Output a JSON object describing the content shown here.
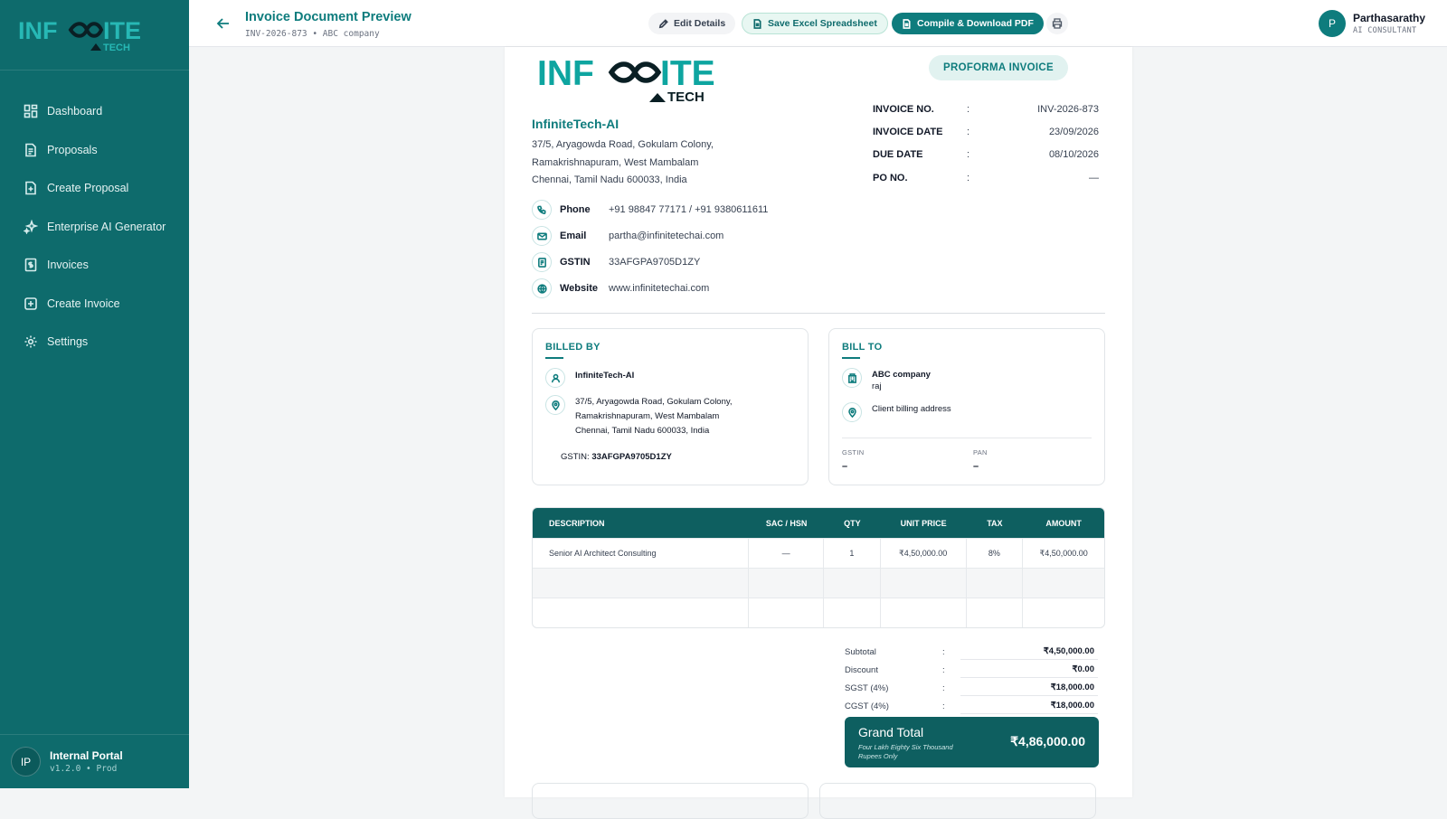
{
  "sidebar": {
    "brand": "INFINITE TECH",
    "items": [
      {
        "label": "Dashboard",
        "icon": "dashboard-icon"
      },
      {
        "label": "Proposals",
        "icon": "document-icon"
      },
      {
        "label": "Create Proposal",
        "icon": "file-plus-icon"
      },
      {
        "label": "Enterprise AI Generator",
        "icon": "sparkles-icon"
      },
      {
        "label": "Invoices",
        "icon": "invoice-icon"
      },
      {
        "label": "Create Invoice",
        "icon": "plus-square-icon"
      },
      {
        "label": "Settings",
        "icon": "gear-icon"
      }
    ],
    "footer": {
      "initials": "IP",
      "title": "Internal Portal",
      "version": "v1.2.0 • Prod"
    }
  },
  "header": {
    "title": "Invoice Document Preview",
    "subtitle": "INV-2026-873 • ABC company",
    "edit_label": "Edit Details",
    "excel_label": "Save Excel Spreadsheet",
    "pdf_label": "Compile & Download PDF",
    "user": {
      "initial": "P",
      "name": "Parthasarathy",
      "role": "AI CONSULTANT"
    }
  },
  "invoice": {
    "badge": "PROFORMA INVOICE",
    "company": "InfiniteTech-AI",
    "address": [
      "37/5, Aryagowda Road, Gokulam Colony,",
      "Ramakrishnapuram, West Mambalam",
      "Chennai, Tamil Nadu 600033, India"
    ],
    "contacts": [
      {
        "label": "Phone",
        "value": "+91 98847 77171 / +91 9380611611"
      },
      {
        "label": "Email",
        "value": "partha@infinitetechai.com"
      },
      {
        "label": "GSTIN",
        "value": "33AFGPA9705D1ZY"
      },
      {
        "label": "Website",
        "value": "www.infinitetechai.com"
      }
    ],
    "meta": [
      {
        "label": "INVOICE NO.",
        "value": "INV-2026-873"
      },
      {
        "label": "INVOICE DATE",
        "value": "23/09/2026"
      },
      {
        "label": "DUE DATE",
        "value": "08/10/2026"
      },
      {
        "label": "PO NO.",
        "value": "—"
      }
    ],
    "colon": ":",
    "billed_by": {
      "heading": "BILLED BY",
      "name": "InfiniteTech-AI",
      "address": [
        "37/5, Aryagowda Road, Gokulam Colony,",
        "Ramakrishnapuram, West Mambalam",
        "Chennai, Tamil Nadu 600033, India"
      ],
      "gstin_label": "GSTIN:",
      "gstin": "33AFGPA9705D1ZY"
    },
    "bill_to": {
      "heading": "BILL TO",
      "name": "ABC company",
      "contact": "raj",
      "address": "Client billing address",
      "gstin_label": "GSTIN",
      "gstin": "–",
      "pan_label": "PAN",
      "pan": "–"
    },
    "table": {
      "headers": [
        "DESCRIPTION",
        "SAC / HSN",
        "QTY",
        "UNIT PRICE",
        "TAX",
        "AMOUNT"
      ],
      "rows": [
        [
          "Senior AI Architect Consulting",
          "—",
          "1",
          "₹4,50,000.00",
          "8%",
          "₹4,50,000.00"
        ],
        [
          "",
          "",
          "",
          "",
          "",
          ""
        ],
        [
          "",
          "",
          "",
          "",
          "",
          ""
        ]
      ]
    },
    "totals": [
      {
        "label": "Subtotal",
        "value": "₹4,50,000.00"
      },
      {
        "label": "Discount",
        "value": "₹0.00"
      },
      {
        "label": "SGST (4%)",
        "value": "₹18,000.00"
      },
      {
        "label": "CGST (4%)",
        "value": "₹18,000.00"
      }
    ],
    "grand_total": {
      "label": "Grand Total",
      "words": "Four Lakh Eighty Six Thousand Rupees Only",
      "value": "₹4,86,000.00"
    }
  },
  "colors": {
    "primary": "#0e7c7d",
    "sidebar": "#0e6b6c",
    "table_head": "#0e5f60"
  }
}
